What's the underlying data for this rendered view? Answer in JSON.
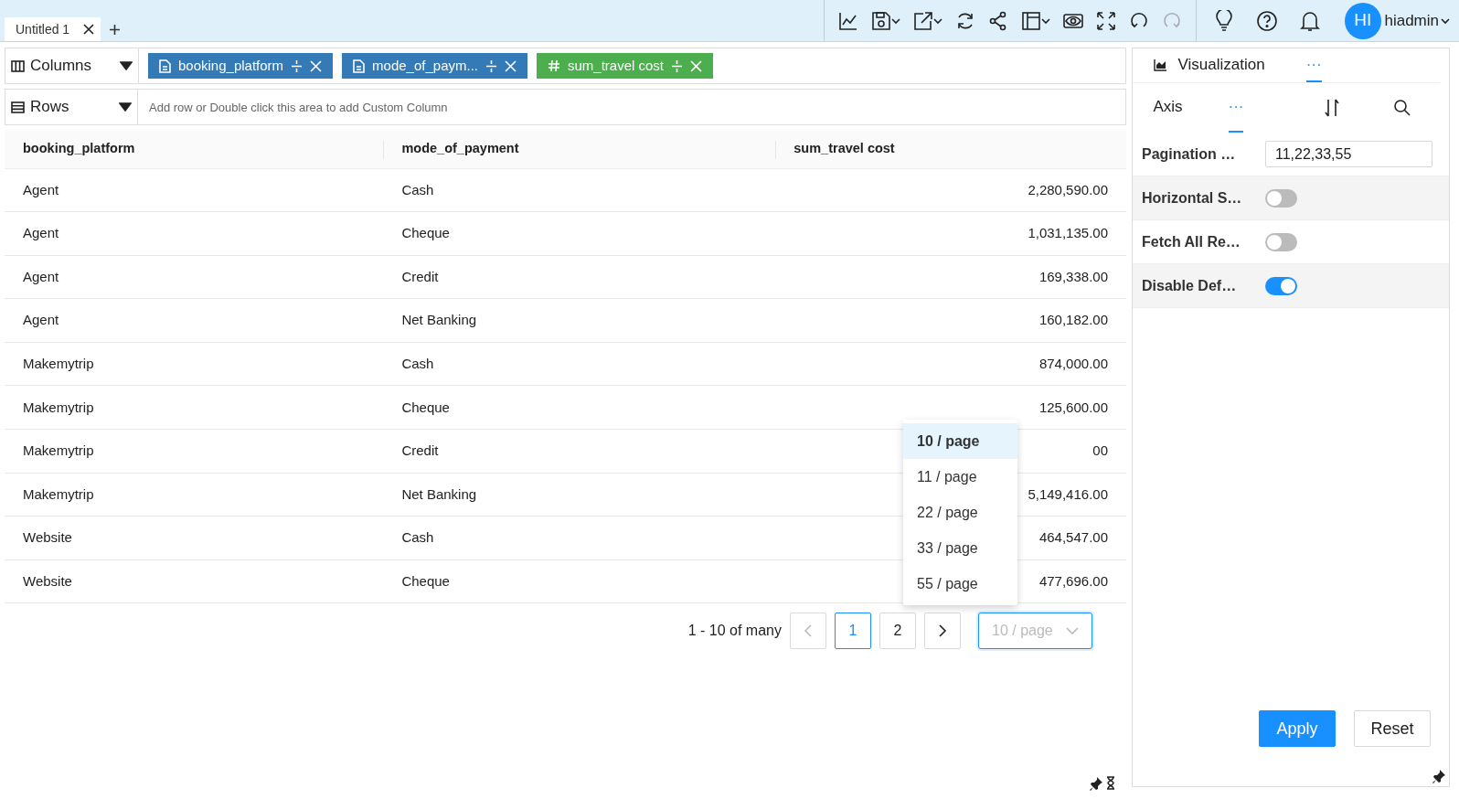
{
  "tab": {
    "title": "Untitled 1"
  },
  "toolbar": [
    {
      "kind": "chart",
      "dropdown": false,
      "disabled": false
    },
    {
      "kind": "save",
      "dropdown": true,
      "disabled": false
    },
    {
      "kind": "export",
      "dropdown": true,
      "disabled": false
    },
    {
      "kind": "refresh",
      "dropdown": false,
      "disabled": false
    },
    {
      "kind": "share",
      "dropdown": false,
      "disabled": false
    },
    {
      "kind": "layout",
      "dropdown": true,
      "disabled": false
    },
    {
      "kind": "eye",
      "dropdown": false,
      "disabled": false
    },
    {
      "kind": "expand",
      "dropdown": false,
      "disabled": false
    },
    {
      "kind": "undo",
      "dropdown": false,
      "disabled": false
    },
    {
      "kind": "redo",
      "dropdown": false,
      "disabled": true
    }
  ],
  "user": {
    "initials": "HI",
    "name": "hiadmin"
  },
  "columns_shelf": {
    "label": "Columns",
    "pills": [
      {
        "kind": "text",
        "label": "booking_platform"
      },
      {
        "kind": "text",
        "label": "mode_of_paym..."
      },
      {
        "kind": "number",
        "label": "sum_travel cost"
      }
    ]
  },
  "rows_shelf": {
    "label": "Rows",
    "placeholder": "Add row or Double click this area to add Custom Column"
  },
  "table": {
    "columns": [
      "booking_platform",
      "mode_of_payment",
      "sum_travel cost"
    ],
    "rows": [
      [
        "Agent",
        "Cash",
        "2,280,590.00"
      ],
      [
        "Agent",
        "Cheque",
        "1,031,135.00"
      ],
      [
        "Agent",
        "Credit",
        "169,338.00"
      ],
      [
        "Agent",
        "Net Banking",
        "160,182.00"
      ],
      [
        "Makemytrip",
        "Cash",
        "874,000.00"
      ],
      [
        "Makemytrip",
        "Cheque",
        "125,600.00"
      ],
      [
        "Makemytrip",
        "Credit",
        "00"
      ],
      [
        "Makemytrip",
        "Net Banking",
        "5,149,416.00"
      ],
      [
        "Website",
        "Cash",
        "464,547.00"
      ],
      [
        "Website",
        "Cheque",
        "477,696.00"
      ]
    ]
  },
  "pagination": {
    "summary": "1 - 10 of many",
    "prev_disabled": true,
    "pages": [
      {
        "label": "1",
        "selected": true
      },
      {
        "label": "2",
        "selected": false
      }
    ],
    "page_size": "10 / page",
    "options": [
      {
        "label": "10 / page",
        "selected": true
      },
      {
        "label": "11 / page",
        "selected": false
      },
      {
        "label": "22 / page",
        "selected": false
      },
      {
        "label": "33 / page",
        "selected": false
      },
      {
        "label": "55 / page",
        "selected": false
      }
    ]
  },
  "panel": {
    "tabs": [
      {
        "label": "Visualization",
        "selected": false
      },
      {
        "label": "···",
        "selected": true
      }
    ],
    "subtabs": [
      {
        "label": "Axis",
        "selected": false
      },
      {
        "label": "···",
        "selected": true
      }
    ],
    "settings": [
      {
        "kind": "text",
        "label": "Pagination …",
        "value": "11,22,33,55"
      },
      {
        "kind": "toggle",
        "label": "Horizontal S…",
        "on": false
      },
      {
        "kind": "toggle",
        "label": "Fetch All Re…",
        "on": false
      },
      {
        "kind": "toggle",
        "label": "Disable Def…",
        "on": true
      }
    ],
    "buttons": [
      {
        "kind": "primary",
        "label": "Apply"
      },
      {
        "kind": "secondary",
        "label": "Reset"
      }
    ]
  }
}
